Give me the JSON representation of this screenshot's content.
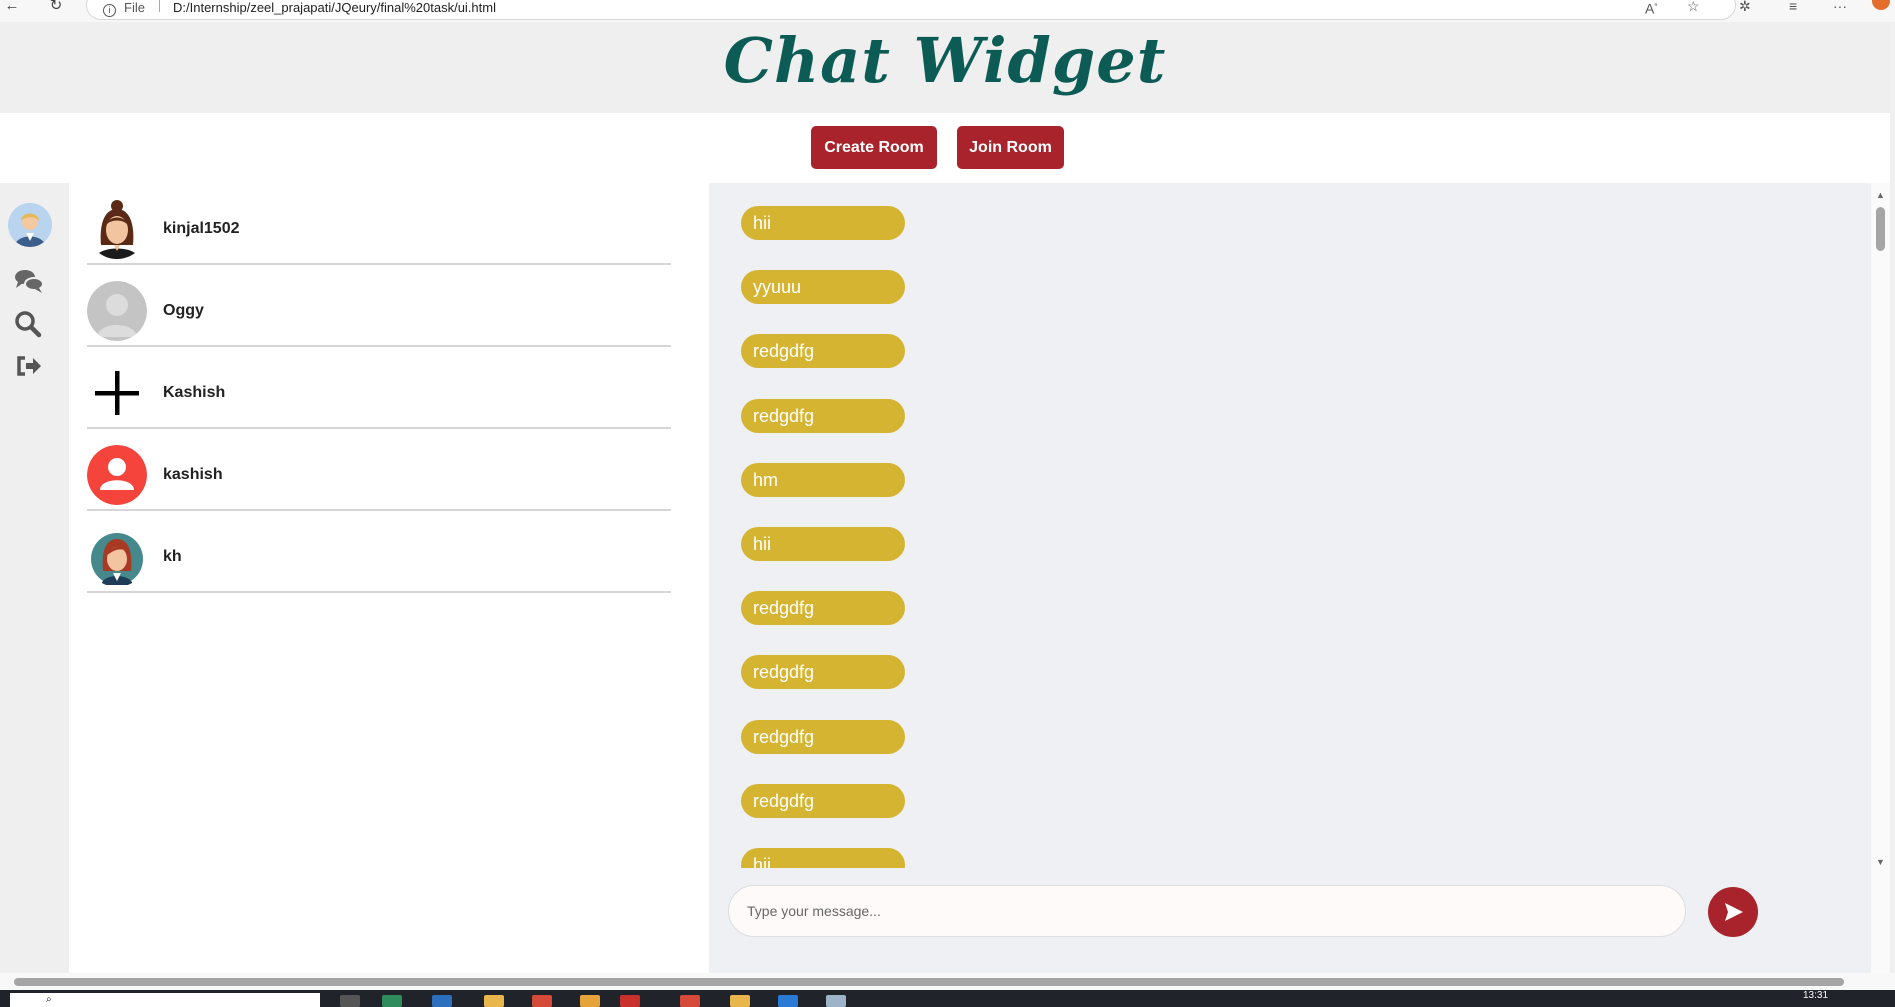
{
  "browser": {
    "file_label": "File",
    "url": "D:/Internship/zeel_prajapati/JQeury/final%20task/ui.html"
  },
  "header": {
    "title": "Chat Widget"
  },
  "rooms": {
    "create_label": "Create Room",
    "join_label": "Join Room"
  },
  "rail": {
    "icons": [
      "user-avatar",
      "chat-icon",
      "search-icon",
      "logout-icon"
    ]
  },
  "contacts": [
    {
      "name": "kinjal1502",
      "avatar": "woman-avatar"
    },
    {
      "name": "Oggy",
      "avatar": "grey-silhouette-avatar"
    },
    {
      "name": "Kashish",
      "avatar": "plus-icon"
    },
    {
      "name": "kashish",
      "avatar": "red-person-avatar"
    },
    {
      "name": "kh",
      "avatar": "redhead-avatar"
    }
  ],
  "messages": [
    "hii",
    "yyuuu",
    "redgdfg",
    "redgdfg",
    "hm",
    "hii",
    "redgdfg",
    "redgdfg",
    "redgdfg",
    "redgdfg",
    "hii"
  ],
  "composer": {
    "placeholder": "Type your message..."
  },
  "taskbar": {
    "clock": "13:31"
  },
  "colors": {
    "accent": "#a8232b",
    "bubble": "#d4b431",
    "title": "#0c5c55",
    "chat_bg": "#eff0f4",
    "panel_bg": "#efefef"
  }
}
